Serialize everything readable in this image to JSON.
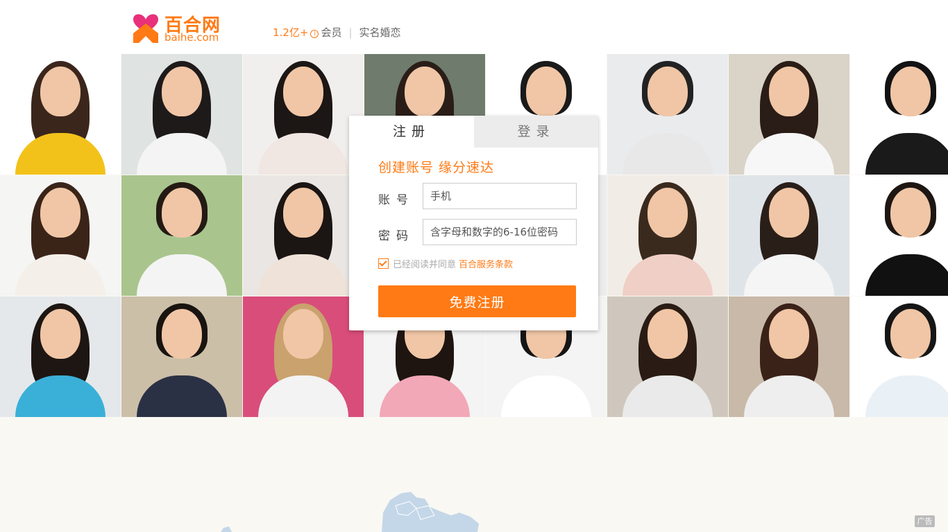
{
  "header": {
    "logo_cn": "百合网",
    "logo_en": "baihe.com",
    "member_count": "1.2亿+",
    "badge": "i",
    "members_label": "会员",
    "separator": "|",
    "real_name_label": "实名婚恋"
  },
  "colors": {
    "brand_orange": "#ff7a14",
    "logo_pink": "#e8317a",
    "page_bg": "#f9f8f3"
  },
  "photo_grid": {
    "tiles": [
      {
        "gender": "female",
        "bg": "#ffffff",
        "shirt": "#f3c21a",
        "hair": "#3b261c"
      },
      {
        "gender": "female",
        "bg": "#dfe3e2",
        "shirt": "#f4f4f4",
        "hair": "#1e1a1a"
      },
      {
        "gender": "female",
        "bg": "#f1eeee",
        "shirt": "#f0e6e2",
        "hair": "#1c1615"
      },
      {
        "gender": "female",
        "bg": "#6f7b6d",
        "shirt": "#d8c9b6",
        "hair": "#2a1d18"
      },
      {
        "gender": "male",
        "bg": "#ffffff",
        "shirt": "#f2f2f2",
        "hair": "#1a1a1a"
      },
      {
        "gender": "male",
        "bg": "#e9ebed",
        "shirt": "#e8e8e8",
        "hair": "#222222"
      },
      {
        "gender": "female",
        "bg": "#d9d3c8",
        "shirt": "#f7f7f7",
        "hair": "#2a1c16"
      },
      {
        "gender": "male",
        "bg": "#ffffff",
        "shirt": "#1a1a1a",
        "hair": "#121212"
      },
      {
        "gender": "female",
        "bg": "#f5f5f4",
        "shirt": "#f4efe8",
        "hair": "#3a2418"
      },
      {
        "gender": "male",
        "bg": "#a9c58d",
        "shirt": "#f4f4f4",
        "hair": "#241a14"
      },
      {
        "gender": "female",
        "bg": "#eae6e3",
        "shirt": "#efe2d8",
        "hair": "#1b1513"
      },
      {
        "gender": "male",
        "bg": "#e7e7e7",
        "shirt": "#efefef",
        "hair": "#201a18"
      },
      {
        "gender": "male",
        "bg": "#ececec",
        "shirt": "#f0f0f0",
        "hair": "#1c1c1c"
      },
      {
        "gender": "female",
        "bg": "#f2ece6",
        "shirt": "#f0cfc6",
        "hair": "#3a2a1e"
      },
      {
        "gender": "female",
        "bg": "#dfe4e8",
        "shirt": "#f5f5f5",
        "hair": "#2a1e18"
      },
      {
        "gender": "male",
        "bg": "#ffffff",
        "shirt": "#111111",
        "hair": "#1e1612"
      },
      {
        "gender": "female",
        "bg": "#e4e8ea",
        "shirt": "#3ab0d8",
        "hair": "#1e1612"
      },
      {
        "gender": "male",
        "bg": "#cbbfa8",
        "shirt": "#2b3145",
        "hair": "#1a1410"
      },
      {
        "gender": "female",
        "bg": "#d94d7a",
        "shirt": "#f3f3f3",
        "hair": "#c9a26e"
      },
      {
        "gender": "female",
        "bg": "#f4f4f4",
        "shirt": "#f2a8b6",
        "hair": "#1e1410"
      },
      {
        "gender": "male",
        "bg": "#f4f4f4",
        "shirt": "#ffffff",
        "hair": "#151515"
      },
      {
        "gender": "female",
        "bg": "#cfc7bd",
        "shirt": "#eaeaea",
        "hair": "#2a1c14"
      },
      {
        "gender": "female",
        "bg": "#c9b9a8",
        "shirt": "#eeeeee",
        "hair": "#3a2218"
      },
      {
        "gender": "male",
        "bg": "#ffffff",
        "shirt": "#e9f0f6",
        "hair": "#161616"
      }
    ]
  },
  "register_panel": {
    "tab_register": "注册",
    "tab_login": "登录",
    "tagline": "创建账号  缘分速达",
    "account_label_1": "账",
    "account_label_2": "号",
    "account_placeholder": "手机",
    "password_label_1": "密",
    "password_label_2": "码",
    "password_placeholder": "含字母和数字的6-16位密码",
    "agree_text": "已经阅读并同意",
    "agree_checked": true,
    "terms_link": "百合服务条款",
    "submit_label": "免费注册"
  },
  "footer": {
    "ad_label": "广告"
  }
}
